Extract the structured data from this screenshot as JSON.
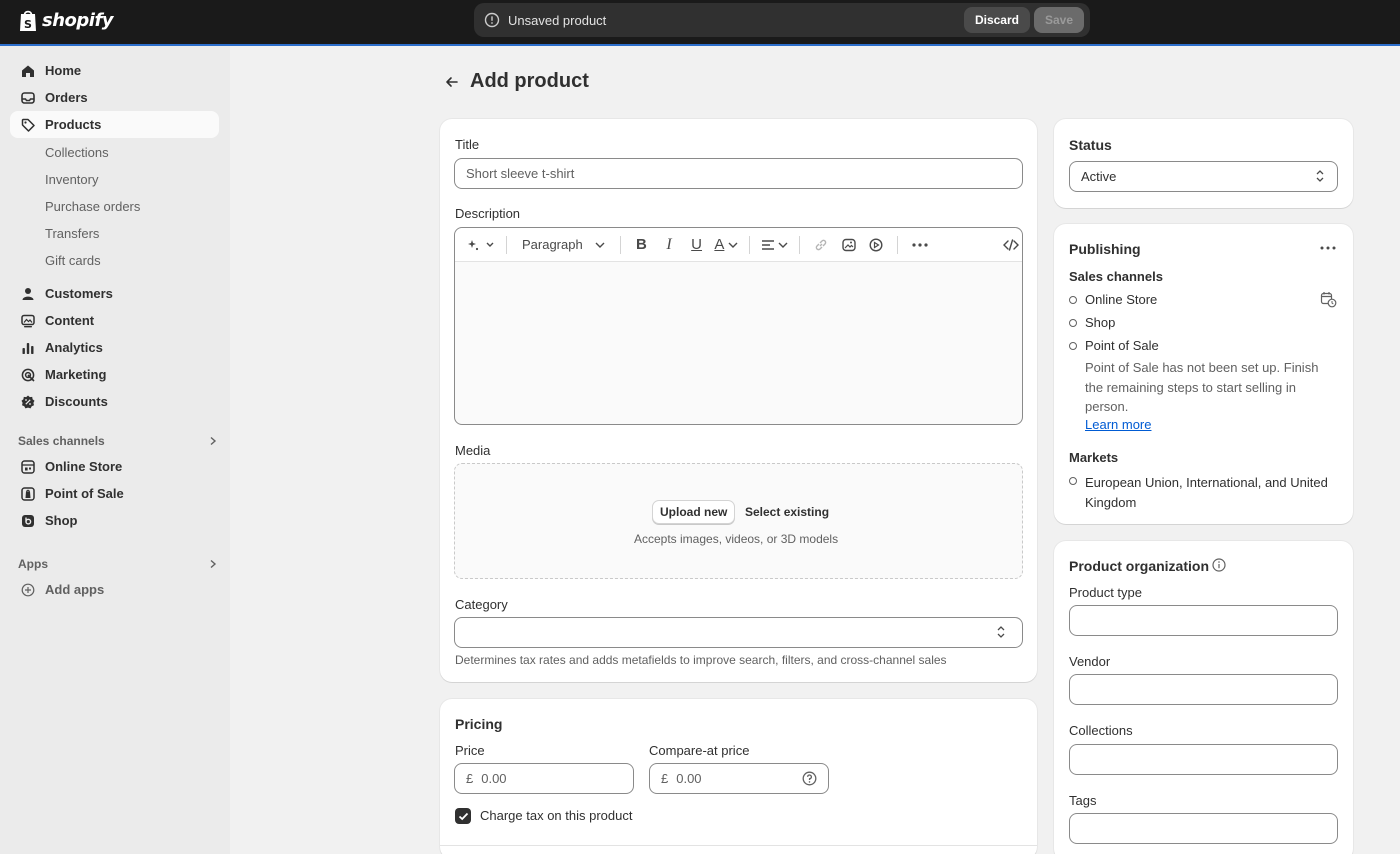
{
  "topbar": {
    "brand": "shopify",
    "unsaved_message": "Unsaved product",
    "discard_label": "Discard",
    "save_label": "Save"
  },
  "sidebar": {
    "items": [
      {
        "label": "Home",
        "icon": "home-icon"
      },
      {
        "label": "Orders",
        "icon": "inbox-icon"
      },
      {
        "label": "Products",
        "icon": "tag-icon",
        "active": true
      },
      {
        "label": "Customers",
        "icon": "person-icon"
      },
      {
        "label": "Content",
        "icon": "content-icon"
      },
      {
        "label": "Analytics",
        "icon": "bar-chart-icon"
      },
      {
        "label": "Marketing",
        "icon": "target-icon"
      },
      {
        "label": "Discounts",
        "icon": "discount-icon"
      }
    ],
    "product_subitems": [
      "Collections",
      "Inventory",
      "Purchase orders",
      "Transfers",
      "Gift cards"
    ],
    "sales_channels_label": "Sales channels",
    "sales_channels": [
      {
        "label": "Online Store",
        "icon": "store-icon"
      },
      {
        "label": "Point of Sale",
        "icon": "pos-icon"
      },
      {
        "label": "Shop",
        "icon": "shop-icon"
      }
    ],
    "apps_label": "Apps",
    "add_apps_label": "Add apps"
  },
  "page": {
    "title": "Add product"
  },
  "product_card": {
    "title_label": "Title",
    "title_placeholder": "Short sleeve t-shirt",
    "description_label": "Description",
    "paragraph_label": "Paragraph",
    "media_label": "Media",
    "upload_new_label": "Upload new",
    "select_existing_label": "Select existing",
    "media_hint": "Accepts images, videos, or 3D models",
    "category_label": "Category",
    "category_help": "Determines tax rates and adds metafields to improve search, filters, and cross-channel sales"
  },
  "pricing": {
    "heading": "Pricing",
    "price_label": "Price",
    "price_currency": "£",
    "price_placeholder": "0.00",
    "compare_label": "Compare-at price",
    "compare_currency": "£",
    "compare_placeholder": "0.00",
    "charge_tax_label": "Charge tax on this product",
    "charge_tax_checked": true
  },
  "status": {
    "heading": "Status",
    "value": "Active"
  },
  "publishing": {
    "heading": "Publishing",
    "sales_channels_label": "Sales channels",
    "channels": [
      "Online Store",
      "Shop",
      "Point of Sale"
    ],
    "pos_note": "Point of Sale has not been set up. Finish the remaining steps to start selling in person.",
    "learn_more": "Learn more",
    "markets_label": "Markets",
    "markets_value": "European Union, International, and United Kingdom"
  },
  "organization": {
    "heading": "Product organization",
    "product_type_label": "Product type",
    "vendor_label": "Vendor",
    "collections_label": "Collections",
    "tags_label": "Tags"
  },
  "colors": {
    "topbar_bg": "#1a1a1a",
    "accent": "#2c6ecb",
    "link": "#005bd3",
    "sidebar_bg": "#ebebeb",
    "page_bg": "#f1f1f1"
  }
}
